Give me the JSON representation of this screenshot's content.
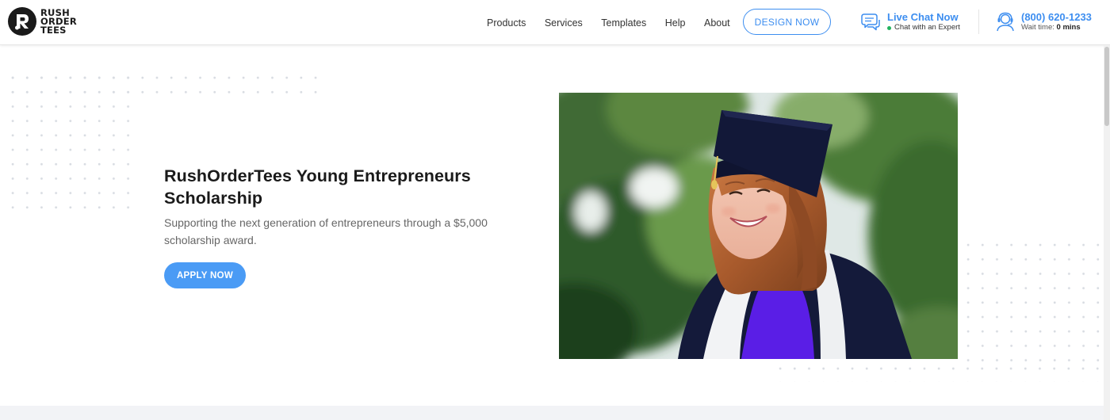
{
  "header": {
    "logo": {
      "line1": "RUSH",
      "line2": "ORDER",
      "line3": "TEES",
      "icon": "r-logo-icon"
    },
    "nav": [
      {
        "label": "Products"
      },
      {
        "label": "Services"
      },
      {
        "label": "Templates"
      },
      {
        "label": "Help"
      },
      {
        "label": "About"
      }
    ],
    "design_button": "DESIGN NOW",
    "chat": {
      "title": "Live Chat Now",
      "subtitle": "Chat with an Expert",
      "icon": "chat-bubble-icon",
      "status_color": "#22b35e"
    },
    "phone": {
      "number": "(800) 620-1233",
      "wait_label": "Wait time:",
      "wait_value": "0 mins",
      "icon": "headset-icon"
    }
  },
  "hero": {
    "title": "RushOrderTees Young Entrepreneurs Scholarship",
    "subtitle": "Supporting the next generation of entrepreneurs through a $5,000 scholarship award.",
    "apply_button": "APPLY NOW",
    "image": "graduate-photo"
  },
  "colors": {
    "accent": "#3d8ef0",
    "button": "#4a9bf5",
    "text": "#1a1a1a",
    "muted": "#666666"
  }
}
